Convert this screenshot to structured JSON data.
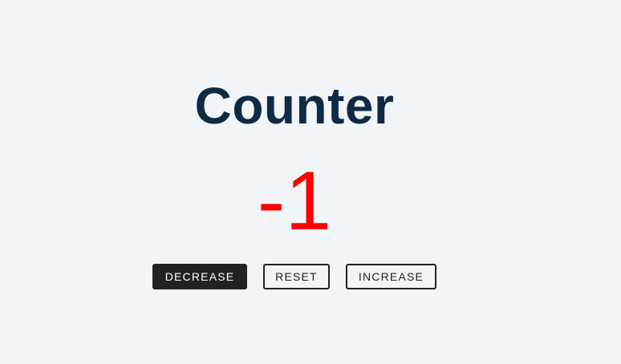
{
  "title": "Counter",
  "count": {
    "value": "-1",
    "color": "#ff0000"
  },
  "buttons": {
    "decrease": "DECREASE",
    "reset": "RESET",
    "increase": "INCREASE"
  },
  "colors": {
    "background": "#f1f5f8",
    "title": "#102a43",
    "button_dark": "#222222"
  }
}
